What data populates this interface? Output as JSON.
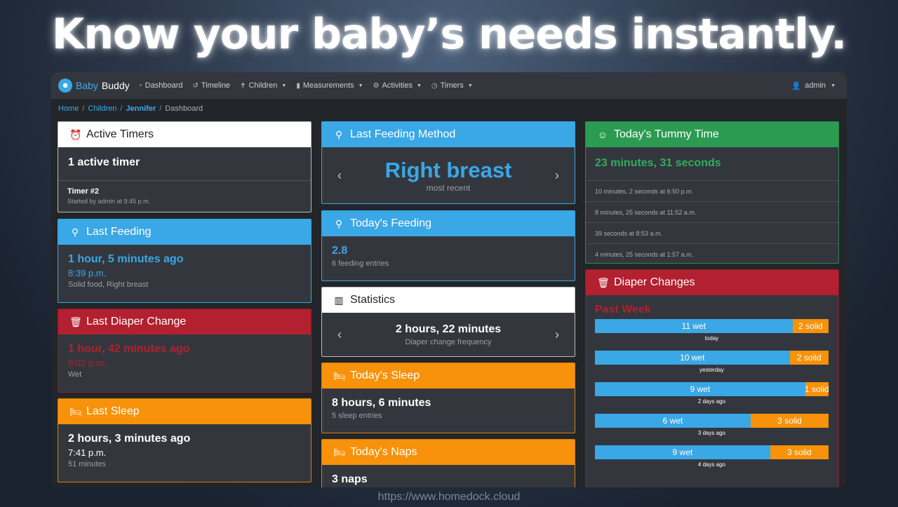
{
  "headline": "Know your baby’s needs instantly.",
  "watermark": "https://www.homedock.cloud",
  "nav": {
    "brand_1": "Baby",
    "brand_2": "Buddy",
    "items": [
      {
        "label": "Dashboard",
        "icon": "dashboard-icon"
      },
      {
        "label": "Timeline",
        "icon": "history-icon"
      },
      {
        "label": "Children",
        "icon": "child-icon"
      },
      {
        "label": "Measurements",
        "icon": "clipboard-icon"
      },
      {
        "label": "Activities",
        "icon": "activities-icon"
      },
      {
        "label": "Timers",
        "icon": "timer-icon"
      }
    ],
    "user": "admin"
  },
  "breadcrumb": {
    "home": "Home",
    "children": "Children",
    "child": "Jennifer",
    "current": "Dashboard"
  },
  "cards": {
    "active_timers": {
      "title": "Active Timers",
      "count": "1 active timer",
      "timer_name": "Timer #2",
      "timer_sub": "Started by admin at 9:45 p.m."
    },
    "last_feeding": {
      "title": "Last Feeding",
      "ago": "1 hour, 5 minutes ago",
      "time": "8:39 p.m.",
      "detail": "Solid food, Right breast"
    },
    "last_diaper": {
      "title": "Last Diaper Change",
      "ago": "1 hour, 42 minutes ago",
      "time": "8:02 p.m.",
      "detail": "Wet"
    },
    "last_sleep": {
      "title": "Last Sleep",
      "ago": "2 hours, 3 minutes ago",
      "time": "7:41 p.m.",
      "detail": "51 minutes"
    },
    "feeding_method": {
      "title": "Last Feeding Method",
      "value": "Right breast",
      "sub": "most recent"
    },
    "todays_feeding": {
      "title": "Today's Feeding",
      "value": "2.8",
      "sub": "6 feeding entries"
    },
    "statistics": {
      "title": "Statistics",
      "value": "2 hours, 22 minutes",
      "sub": "Diaper change frequency"
    },
    "todays_sleep": {
      "title": "Today's Sleep",
      "value": "8 hours, 6 minutes",
      "sub": "5 sleep entries"
    },
    "todays_naps": {
      "title": "Today's Naps",
      "value": "3 naps"
    },
    "tummy_time": {
      "title": "Today's Tummy Time",
      "total": "23 minutes, 31 seconds",
      "entries": [
        "10 minutes, 2 seconds at 6:50 p.m.",
        "8 minutes, 25 seconds at 11:52 a.m.",
        "39 seconds at 8:53 a.m.",
        "4 minutes, 25 seconds at 1:57 a.m."
      ]
    },
    "diaper_changes": {
      "title": "Diaper Changes",
      "period": "Past Week",
      "days": [
        {
          "wet": 11,
          "solid": 2,
          "wet_label": "11 wet",
          "solid_label": "2 solid",
          "day": "today"
        },
        {
          "wet": 10,
          "solid": 2,
          "wet_label": "10 wet",
          "solid_label": "2 solid",
          "day": "yesterday"
        },
        {
          "wet": 9,
          "solid": 1,
          "wet_label": "9 wet",
          "solid_label": "1 solid",
          "day": "2 days ago"
        },
        {
          "wet": 6,
          "solid": 3,
          "wet_label": "6 wet",
          "solid_label": "3 solid",
          "day": "3 days ago"
        },
        {
          "wet": 9,
          "solid": 3,
          "wet_label": "9 wet",
          "solid_label": "3 solid",
          "day": "4 days ago"
        }
      ]
    }
  }
}
